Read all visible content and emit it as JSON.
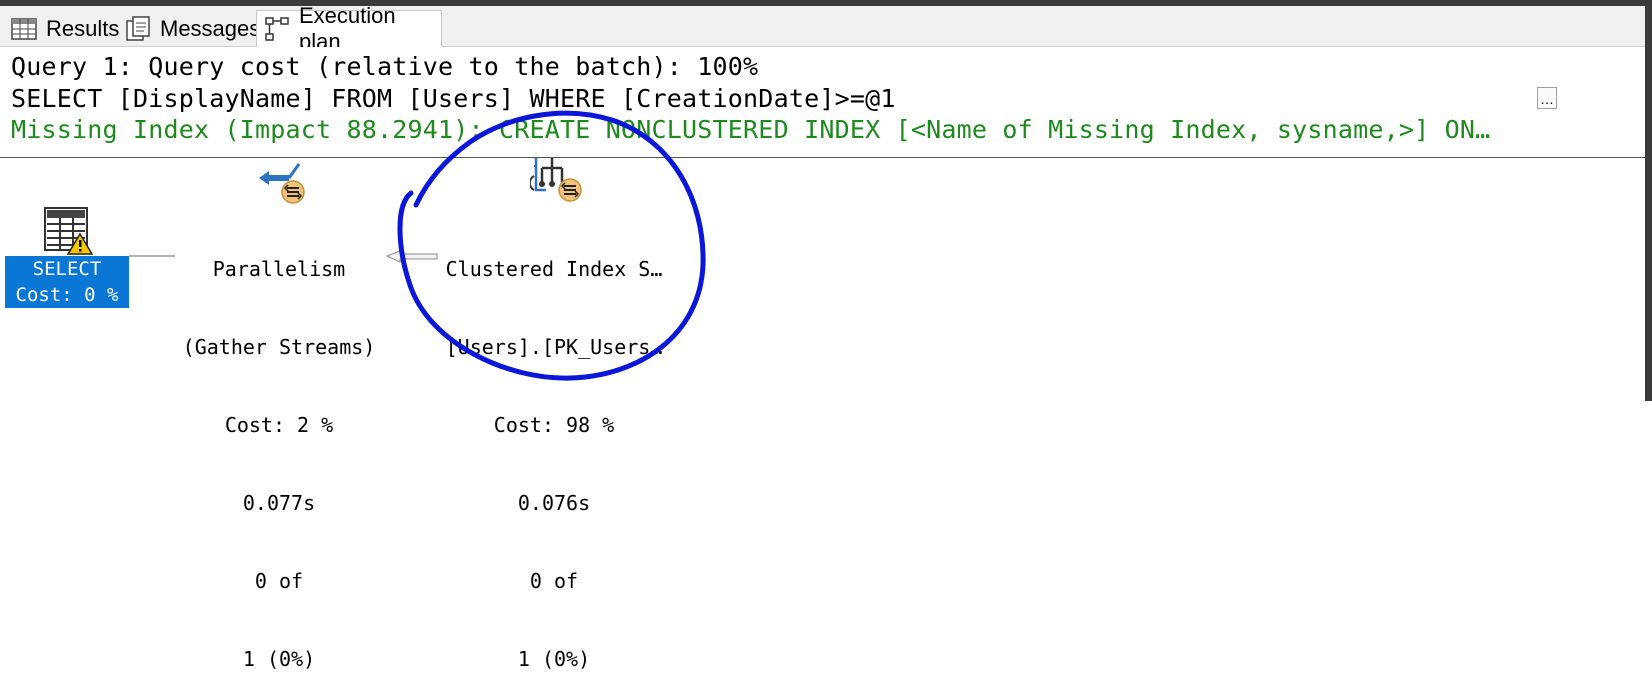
{
  "tabs": [
    {
      "label": "Results",
      "icon": "grid-icon"
    },
    {
      "label": "Messages",
      "icon": "messages-icon"
    },
    {
      "label": "Execution plan",
      "icon": "execution-plan-icon"
    }
  ],
  "header": {
    "query_line": "Query 1: Query cost (relative to the batch): 100%",
    "sql_line": "SELECT [DisplayName] FROM [Users] WHERE [CreationDate]>=@1",
    "missing_index_line": "Missing Index (Impact 88.2941): CREATE NONCLUSTERED INDEX [<Name of Missing Index, sysname,>] ON…",
    "more_button": "…"
  },
  "plan": {
    "select": {
      "label": "SELECT",
      "cost": "Cost: 0 %",
      "icon": "select-grid-warning-icon"
    },
    "parallelism": {
      "name": "Parallelism",
      "sub": "(Gather Streams)",
      "cost": "Cost: 2 %",
      "time": "0.077s",
      "rows_line1": "0 of",
      "rows_line2": "1 (0%)",
      "icon": "parallelism-icon"
    },
    "clustered": {
      "name": "Clustered Index S…",
      "sub": "[Users].[PK_Users…",
      "cost": "Cost: 98 %",
      "time": "0.076s",
      "rows_line1": "0 of",
      "rows_line2": "1 (0%)",
      "icon": "clustered-index-scan-icon"
    }
  },
  "colors": {
    "selected_node": "#0b77d4",
    "missing_index_text": "#1e8a1e",
    "annotation_circle": "#0a16d8"
  }
}
